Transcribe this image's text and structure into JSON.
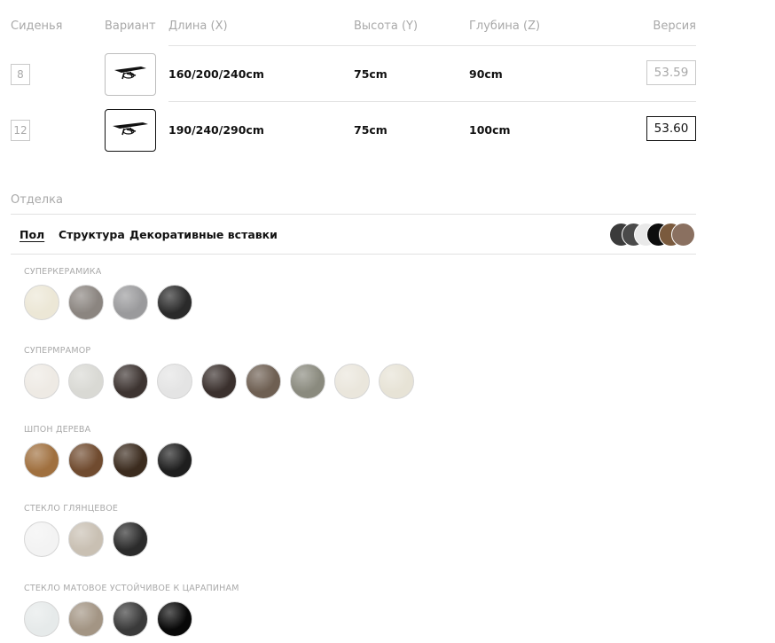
{
  "table": {
    "headers": {
      "seats": "Сиденья",
      "variant": "Вариант",
      "length": "Длина (X)",
      "height": "Высота (Y)",
      "depth": "Глубина (Z)",
      "version": "Версия"
    },
    "rows": [
      {
        "seats": "8",
        "variant_icon": "extending-table-icon",
        "length": "160/200/240cm",
        "height": "75cm",
        "depth": "90cm",
        "version": "53.59",
        "selected": false
      },
      {
        "seats": "12",
        "variant_icon": "extending-table-icon",
        "length": "190/240/290cm",
        "height": "75cm",
        "depth": "100cm",
        "version": "53.60",
        "selected": true
      }
    ]
  },
  "finish": {
    "title": "Отделка",
    "tabs": [
      "Пол",
      "Структура",
      "Декоративные вставки"
    ],
    "active_tab": "Пол",
    "preview_colors": [
      "#3b3b3b",
      "#4a4a4a",
      "#e9e9e9",
      "#0d0d0d",
      "#7a5a3d",
      "#8a7060"
    ],
    "groups": [
      {
        "label": "Суперкерамика",
        "swatches": [
          "#ece7d6",
          "#8b8580",
          "#9a9a9c",
          "#2a2a2a"
        ]
      },
      {
        "label": "Супермрамор",
        "swatches": [
          "#eeeae4",
          "#d9d9d4",
          "#3d3431",
          "#e4e4e4",
          "#3a302d",
          "#6e5f52",
          "#8a8a7e",
          "#eae6dc",
          "#e7e3d6"
        ]
      },
      {
        "label": "Шпон дерева",
        "swatches": [
          "#a0703f",
          "#704b2f",
          "#3b2b1e",
          "#1e1e1e"
        ]
      },
      {
        "label": "Стекло глянцевое",
        "swatches": [
          "#f3f3f3",
          "#c9c0b3",
          "#2b2b2b"
        ]
      },
      {
        "label": "Стекло матовое устойчивое к царапинам",
        "swatches": [
          "#e6eaea",
          "#a39584",
          "#3a3a3a",
          "#080808"
        ]
      }
    ]
  }
}
